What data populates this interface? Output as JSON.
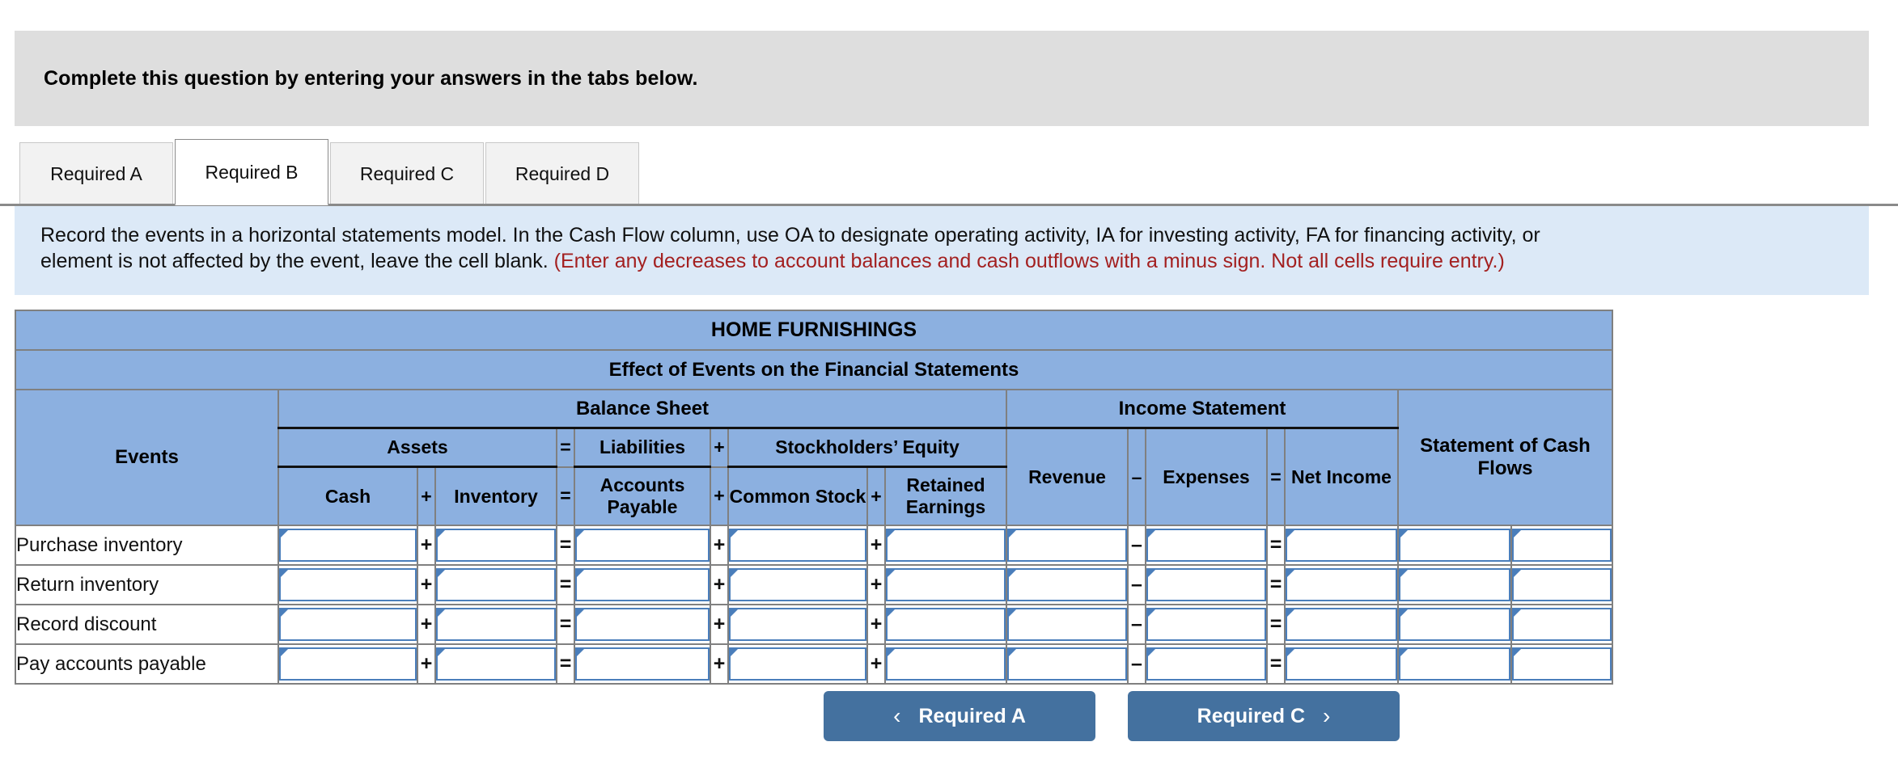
{
  "banner": {
    "text": "Complete this question by entering your answers in the tabs below."
  },
  "tabs": [
    {
      "label": "Required A",
      "active": false
    },
    {
      "label": "Required B",
      "active": true
    },
    {
      "label": "Required C",
      "active": false
    },
    {
      "label": "Required D",
      "active": false
    }
  ],
  "hint": {
    "line1": "Record the events in a horizontal statements model. In the Cash Flow column, use OA to designate operating activity, IA for investing activity, FA for financing activity, or",
    "line2_black": "element is not affected by the event, leave the cell blank.",
    "line2_red": "(Enter any decreases to account balances and cash outflows with a minus sign. Not all cells require entry.)"
  },
  "table": {
    "company": "HOME FURNISHINGS",
    "subtitle": "Effect of Events on the Financial Statements",
    "events_header": "Events",
    "groups": {
      "balance_sheet": "Balance Sheet",
      "income_statement": "Income Statement",
      "cash_flows": "Statement of Cash Flows"
    },
    "subgroups": {
      "assets": "Assets",
      "liabilities": "Liabilities",
      "stockholders_equity": "Stockholders’ Equity"
    },
    "columns": {
      "cash": "Cash",
      "inventory": "Inventory",
      "accounts_payable": "Accounts Payable",
      "common_stock": "Common Stock",
      "retained_earnings": "Retained Earnings",
      "revenue": "Revenue",
      "expenses": "Expenses",
      "net_income": "Net Income"
    },
    "operators": {
      "plus": "+",
      "equals": "=",
      "minus": "–"
    },
    "rows": [
      {
        "event": "Purchase inventory"
      },
      {
        "event": "Return inventory"
      },
      {
        "event": "Record discount"
      },
      {
        "event": "Pay accounts payable"
      }
    ]
  },
  "nav": {
    "prev_label": "Required A",
    "next_label": "Required C",
    "prev_icon": "‹",
    "next_icon": "›"
  },
  "colors": {
    "header_blue": "#8cb0e0",
    "hint_blue": "#dce9f7",
    "banner_gray": "#dedede",
    "button_blue": "#44719f",
    "input_border": "#4a7ebb",
    "warning_red": "#a32020"
  }
}
